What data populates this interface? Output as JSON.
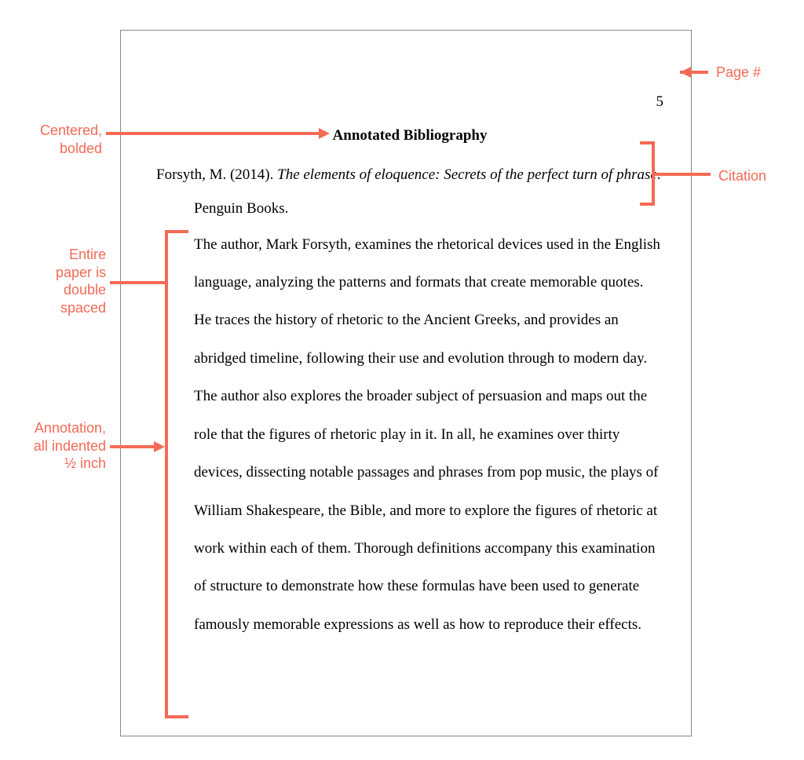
{
  "page": {
    "number": "5",
    "title": "Annotated Bibliography",
    "citation_author": "Forsyth, M. (2014). ",
    "citation_title": "The elements of eloquence: Secrets of the perfect turn of phrase",
    "citation_publisher": ". Penguin Books.",
    "annotation": "The author, Mark Forsyth, examines the rhetorical devices used in the English language, analyzing the patterns and formats that create memorable quotes. He traces the history of rhetoric to the Ancient Greeks, and provides an abridged timeline, following their use and evolution through to modern day. The author also explores the broader subject of persuasion and maps out the role that the figures of rhetoric play in it. In all, he examines over thirty devices, dissecting notable passages and phrases from pop music, the plays of William Shakespeare, the Bible, and more to explore the figures of rhetoric at work within each of them. Thorough definitions accompany this examination of structure to demonstrate how these formulas have been used to generate famously memorable expressions as well as how to reproduce their effects."
  },
  "labels": {
    "page_num": "Page #",
    "centered_bolded": "Centered,\nbolded",
    "citation": "Citation",
    "double_spaced": "Entire\npaper is\ndouble\nspaced",
    "annotation_indent": "Annotation,\nall indented\n½ inch"
  }
}
